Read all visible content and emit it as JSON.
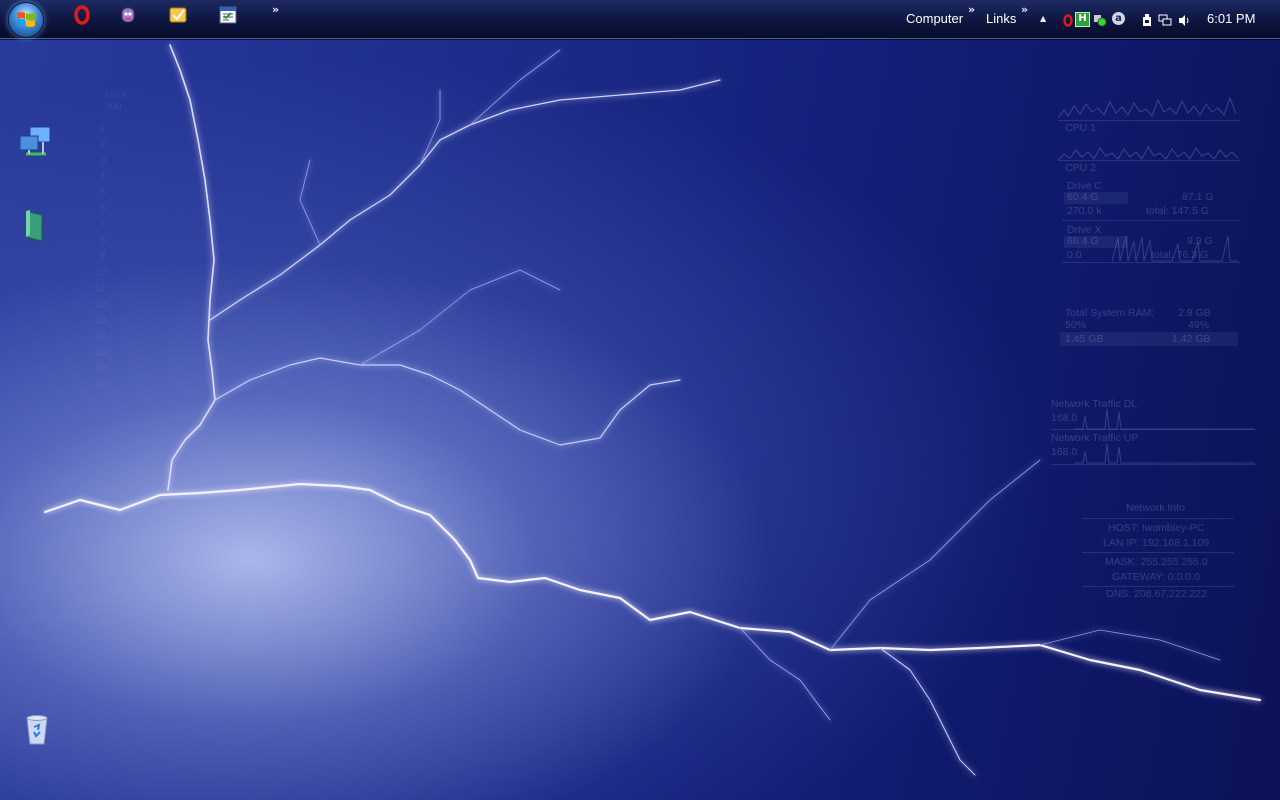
{
  "taskbar": {
    "quick_launch": [
      {
        "name": "opera-icon"
      },
      {
        "name": "pidgin-icon"
      },
      {
        "name": "mail-icon"
      },
      {
        "name": "calendar-icon"
      }
    ],
    "overflow_glyph": "»",
    "toolbars": [
      {
        "label": "Computer",
        "overflow_glyph": "»"
      },
      {
        "label": "Links",
        "overflow_glyph": "»"
      }
    ],
    "tray": {
      "show_hidden_glyph": "▲",
      "icons": [
        "opera-tray-icon",
        "h-tray-icon",
        "status-dot-icon",
        "a-tray-icon",
        "safely-remove-icon",
        "network-icon",
        "volume-icon"
      ],
      "h_letter": "H",
      "a_letter": "a"
    },
    "clock": "6:01 PM"
  },
  "desktop_icons": [
    {
      "name": "network-desktop-icon"
    },
    {
      "name": "folder-desktop-icon"
    },
    {
      "name": "recycle-bin-icon"
    }
  ],
  "left_gadget": {
    "header": [
      "Mo a",
      "nuo"
    ],
    "numbers": [
      "1",
      "2",
      "3",
      "4",
      "5",
      "6",
      "7",
      "8",
      "9",
      "10",
      "11",
      "12",
      "13",
      "14",
      "15",
      "16",
      "17"
    ]
  },
  "cpu_gadget": {
    "cpu1_label": "CPU 1",
    "cpu2_label": "CPU 2"
  },
  "drive_gadget": {
    "drives": [
      {
        "label": "Drive C",
        "used": "60.4 G",
        "free": "87.1 G",
        "io": "270.0 k",
        "total": "total: 147.5 G"
      },
      {
        "label": "Drive X",
        "used": "66.4 G",
        "free": "9.9 G",
        "io": "0.0",
        "total": "total: 76.3 G"
      }
    ]
  },
  "ram_gadget": {
    "label": "Total System RAM:",
    "total": "2.9 GB",
    "used_pct": "50%",
    "free_pct": "49%",
    "used": "1.45 GB",
    "free": "1.42 GB"
  },
  "network_traffic": {
    "dl_label": "Network Traffic DL",
    "dl_value": "168.0",
    "ul_label": "Network Traffic UP",
    "ul_value": "168.0"
  },
  "network_info": {
    "title": "Network Info",
    "host": "HOST: twombley-PC",
    "lan_ip": "LAN IP: 192.168.1.109",
    "mask": "MASK: 255.255.255.0",
    "gateway": "GATEWAY: 0.0.0.0",
    "dns": "DNS: 208.67.222.222"
  }
}
